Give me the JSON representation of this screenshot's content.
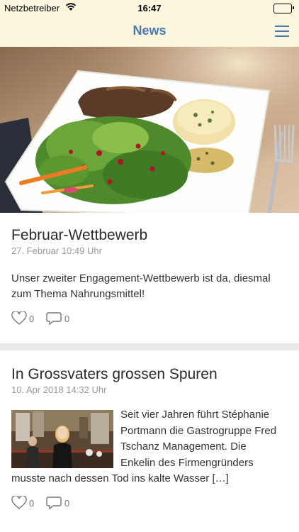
{
  "status_bar": {
    "carrier": "Netzbetreiber",
    "time": "16:47"
  },
  "nav": {
    "title": "News",
    "menu_icon": "hamburger-menu-icon"
  },
  "articles": [
    {
      "title": "Februar-Wettbewerb",
      "date": "27. Februar 10:49 Uhr",
      "teaser": "Unser zweiter Engagement-Wettbewerb ist da, diesmal zum Thema Nahrungsmittel!",
      "likes": "0",
      "comments": "0"
    },
    {
      "title": "In Grossvaters grossen Spuren",
      "date": "10. Apr 2018 14:32 Uhr",
      "teaser": "Seit vier Jahren führt Stéphanie Portmann die Gastrogruppe Fred Tschanz Management. Die Enkelin des Firmengründers musste nach dessen Tod ins kalte Wasser […]",
      "likes": "0",
      "comments": "0"
    }
  ],
  "colors": {
    "bar_background": "#fbf6dd",
    "accent": "#4a78b0"
  }
}
